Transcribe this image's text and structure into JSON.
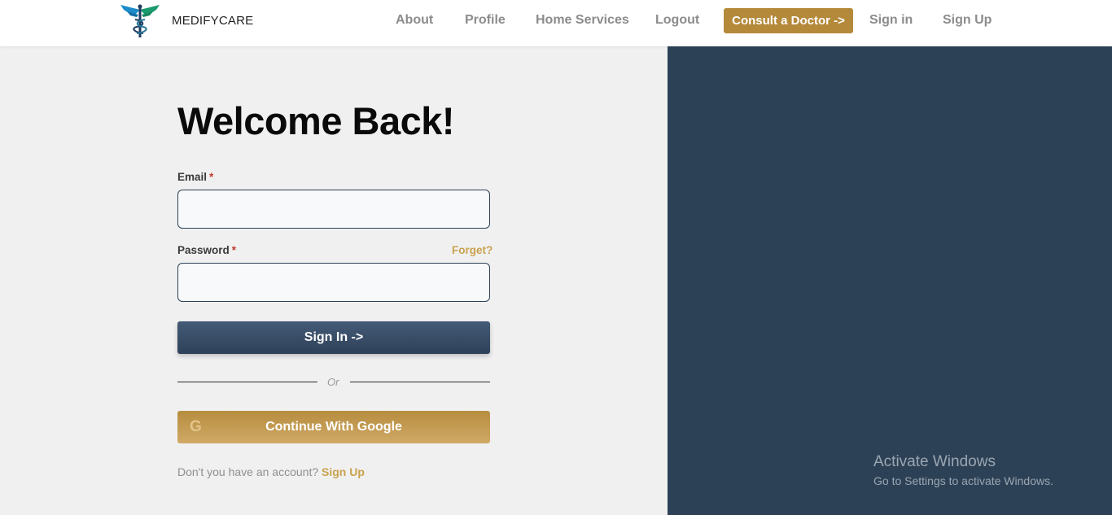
{
  "header": {
    "brand": "MEDIFYCARE",
    "nav": {
      "about": "About",
      "profile": "Profile",
      "home_services": "Home Services",
      "logout": "Logout",
      "consult": "Consult a Doctor ->",
      "signin": "Sign in",
      "signup": "Sign Up"
    }
  },
  "form": {
    "title": "Welcome Back!",
    "email_label": "Email",
    "email_value": "",
    "password_label": "Password",
    "password_value": "",
    "required_mark": "*",
    "forget": "Forget?",
    "signin_button": "Sign In ->",
    "divider": "Or",
    "google_button": "Continue With Google",
    "google_icon_glyph": "G",
    "no_account": "Don't you have an account?",
    "signup_link": "Sign Up"
  },
  "watermark": {
    "title": "Activate Windows",
    "subtitle": "Go to Settings to activate Windows."
  },
  "colors": {
    "accent": "#b5893a",
    "panel": "#2d4156",
    "primary_button": "#3a4f6a"
  }
}
